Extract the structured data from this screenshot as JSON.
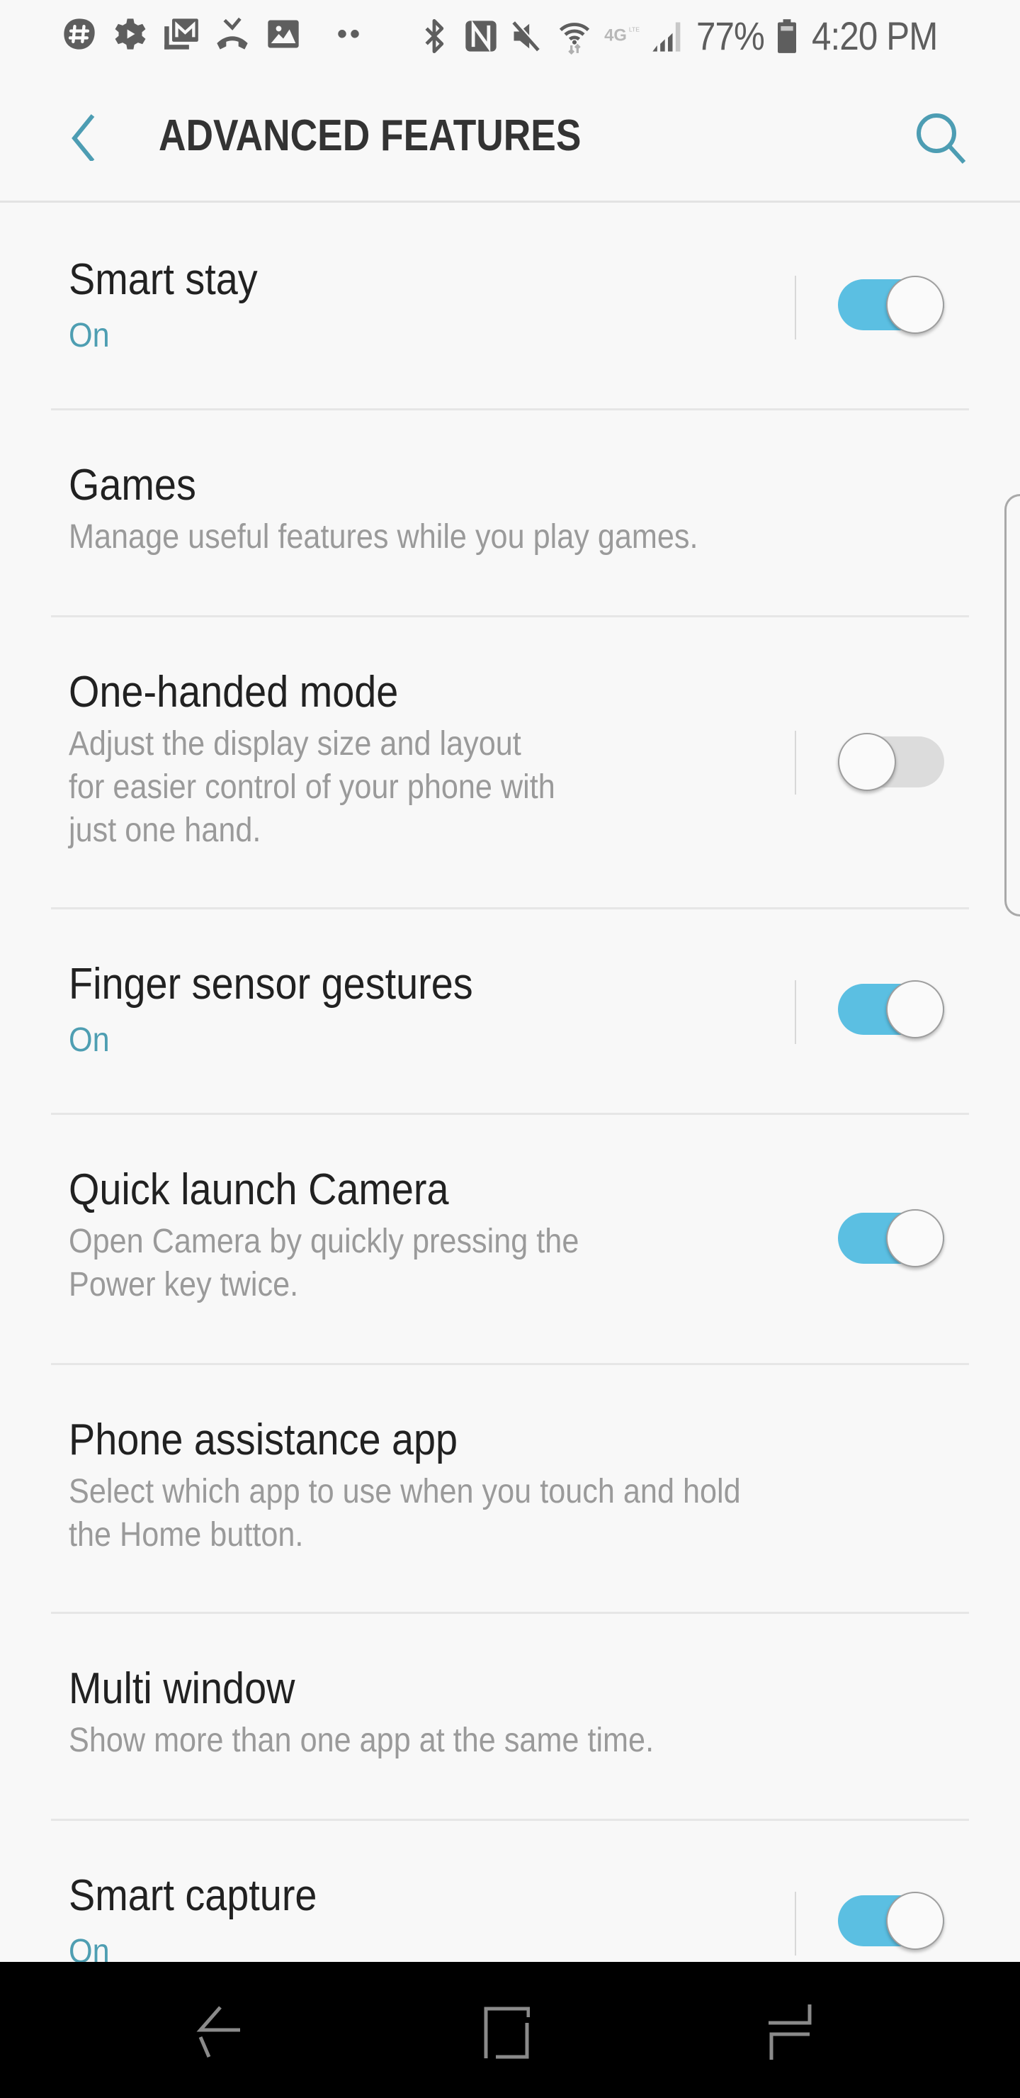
{
  "status_bar": {
    "left_icons": [
      "slack-icon",
      "settings-icon",
      "gmail-icon",
      "missed-call-icon",
      "gallery-icon"
    ],
    "overflow": "••",
    "right_icons": [
      "bluetooth-icon",
      "nfc-icon",
      "mute-icon",
      "wifi-icon",
      "4g-lte-icon",
      "signal-icon"
    ],
    "battery_percent": "77%",
    "battery_level": 0.77,
    "time": "4:20 PM"
  },
  "header": {
    "title": "ADVANCED FEATURES",
    "back_icon": "chevron-left-icon",
    "search_icon": "search-icon"
  },
  "accent_color": "#5bbfe2",
  "status_text_color": "#4e9eb2",
  "settings": [
    {
      "title": "Smart stay",
      "status": "On",
      "toggle": true
    },
    {
      "title": "Games",
      "subtitle": [
        "Manage useful features while you play games."
      ]
    },
    {
      "title": "One-handed mode",
      "subtitle": [
        "Adjust the display size and layout",
        "for easier control of your phone with",
        "just one hand."
      ],
      "toggle": false
    },
    {
      "title": "Finger sensor gestures",
      "status": "On",
      "toggle": true
    },
    {
      "title": "Quick launch Camera",
      "subtitle": [
        "Open Camera by quickly pressing the",
        "Power key twice."
      ],
      "toggle": true
    },
    {
      "title": "Phone assistance app",
      "subtitle": [
        "Select which app to use when you touch and hold",
        "the Home button."
      ]
    },
    {
      "title": "Multi window",
      "subtitle": [
        "Show more than one app at the same time."
      ]
    },
    {
      "title": "Smart capture",
      "status": "On",
      "toggle": true
    }
  ],
  "nav_bar": {
    "back": "back-icon",
    "home": "home-icon",
    "recents": "recents-icon"
  }
}
